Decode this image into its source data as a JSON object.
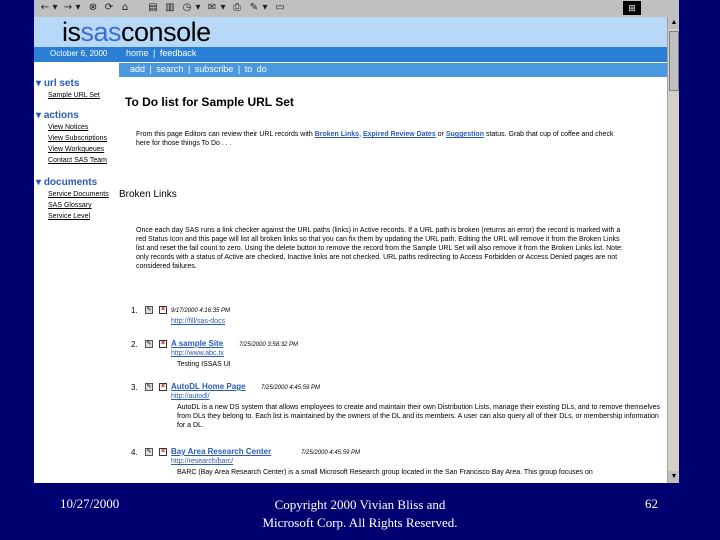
{
  "browser": {
    "toolbar_buttons": [
      "←",
      "▾",
      "→",
      "▾",
      "⊗",
      "⟳",
      "⌂",
      "▤",
      "▥",
      "◷",
      "▾",
      "✉",
      "▾",
      "⎙",
      "✎",
      "▾",
      "▭"
    ],
    "windows_logo": "⊞"
  },
  "site": {
    "logo_part1": "is",
    "logo_part2": "sas",
    "logo_part3": "console",
    "date": "October 6, 2000",
    "nav_primary": [
      "home",
      "|",
      "feedback"
    ],
    "nav_secondary": [
      "add",
      "|",
      "search",
      "|",
      "subscribe",
      "|",
      "to do"
    ]
  },
  "sidebar": {
    "url_sets": {
      "title": "url sets",
      "items": [
        "Sample URL Set"
      ]
    },
    "actions": {
      "title": "actions",
      "items": [
        "View Notices",
        "View Subscriptions",
        "View Workqueues",
        "Contact SAS Team"
      ]
    },
    "documents": {
      "title": "documents",
      "items": [
        "Service Documents",
        "SAS Glossary",
        "Service Level"
      ]
    }
  },
  "main": {
    "title": "To Do list for Sample URL Set",
    "intro_text": "From this page Editors can review their URL records with",
    "intro_link1": "Broken Links",
    "intro_link2": "Expired Review Dates",
    "intro_or": "or",
    "intro_link3": "Suggestion",
    "intro_text2": "status. Grab that cup of coffee and check here for those things To Do . . .",
    "section_title": "Broken Links",
    "section_text": "Once each day SAS runs a link checker against the URL paths (links) in Active records. If a URL path is broken (returns an error) the record is marked with a red Status Icon and this page will list all broken links so that you can fix them by updating the URL path. Editing the URL will remove it from the Broken Links list and reset the fail count to zero. Using the delete button to remove the record from the Sample URL Set will also remove it from the Broken Links list. Note: only records with a status of Active are checked, Inactive links are not checked. URL paths redirecting to Access Forbidden or Access Denied pages are not considered failures.",
    "items": [
      {
        "num": "1.",
        "link": "",
        "date": "9/17/2000 4:16:35 PM",
        "url": "http://fill/sas-docs",
        "desc": ""
      },
      {
        "num": "2.",
        "link": "A sample Site",
        "date": "7/25/2000 3:58:32 PM",
        "url": "http://www.abc.tx",
        "desc": "Testing ISSAS UI"
      },
      {
        "num": "3.",
        "link": "AutoDL Home Page",
        "date": "7/25/2000 4:45:59 PM",
        "url": "http://autodl/",
        "desc": "AutoDL is a new DS system that allows employees to create and maintain their own Distribution Lists, manage their existing DLs, and to remove themselves from DLs they belong to. Each list is maintained by the owners of the DL and its members. A user can also query all of their DLs, or membership information for a DL."
      },
      {
        "num": "4.",
        "link": "Bay Area Research Center",
        "date": "7/25/2000 4:45:59 PM",
        "url": "http://research/barc/",
        "desc": "BARC (Bay Area Research Center) is a small Microsoft Research group located in the San Francisco Bay Area. This group focuses on"
      }
    ]
  },
  "slide": {
    "date": "10/27/2000",
    "copyright_line1": "Copyright 2000 Vivian Bliss and",
    "copyright_line2": "Microsoft Corp. All Rights Reserved.",
    "page_number": "62"
  },
  "colors": {
    "slide_background": "#000070",
    "header_bar": "#b8d8f8",
    "nav_bar": "#2a7fd4",
    "sub_nav_bar": "#4a98e0",
    "link": "#2a5bb8",
    "logo_accent": "#3a6fd0"
  }
}
